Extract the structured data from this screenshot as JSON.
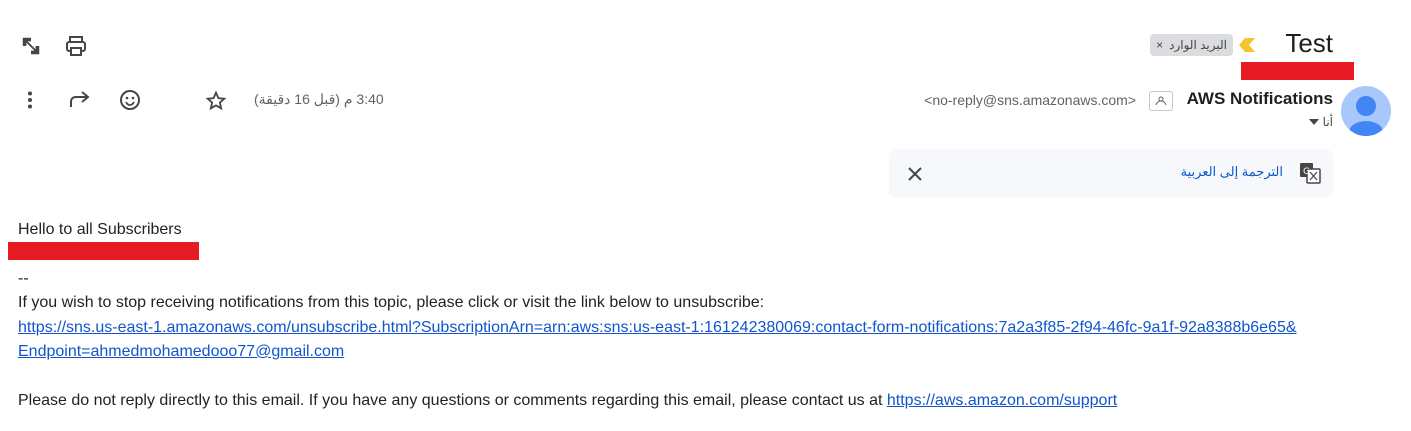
{
  "toolbar": {
    "expand_icon": "open-in-new-window-icon",
    "print_icon": "print-icon"
  },
  "subject": "Test",
  "label_chip": {
    "label": "البريد الوارد",
    "remove": "×"
  },
  "sender": {
    "name": "AWS Notifications",
    "email": "<no-reply@sns.amazonaws.com>",
    "to": "أنا"
  },
  "message_meta": {
    "time": "3:40 م (قبل 16 دقيقة)"
  },
  "translate": {
    "label": "الترجمة إلى العربية"
  },
  "body": {
    "greeting": "Hello to all Subscribers",
    "separator": "--",
    "unsubscribe_text": "If you wish to stop receiving notifications from this topic, please click or visit the link below to unsubscribe:",
    "unsubscribe_link_line1": "https://sns.us-east-1.amazonaws.com/unsubscribe.html?SubscriptionArn=arn:aws:sns:us-east-1:161242380069:contact-form-notifications:7a2a3f85-2f94-46fc-9a1f-92a8388b6e65&",
    "unsubscribe_link_line2": "Endpoint=ahmedmohamedooo77@gmail.com",
    "footer_text": "Please do not reply directly to this email. If you have any questions or comments regarding this email, please contact us at ",
    "support_link": "https://aws.amazon.com/support"
  },
  "colors": {
    "redaction": "#e61b23",
    "link": "#1155cc",
    "importance": "#f4c430"
  }
}
